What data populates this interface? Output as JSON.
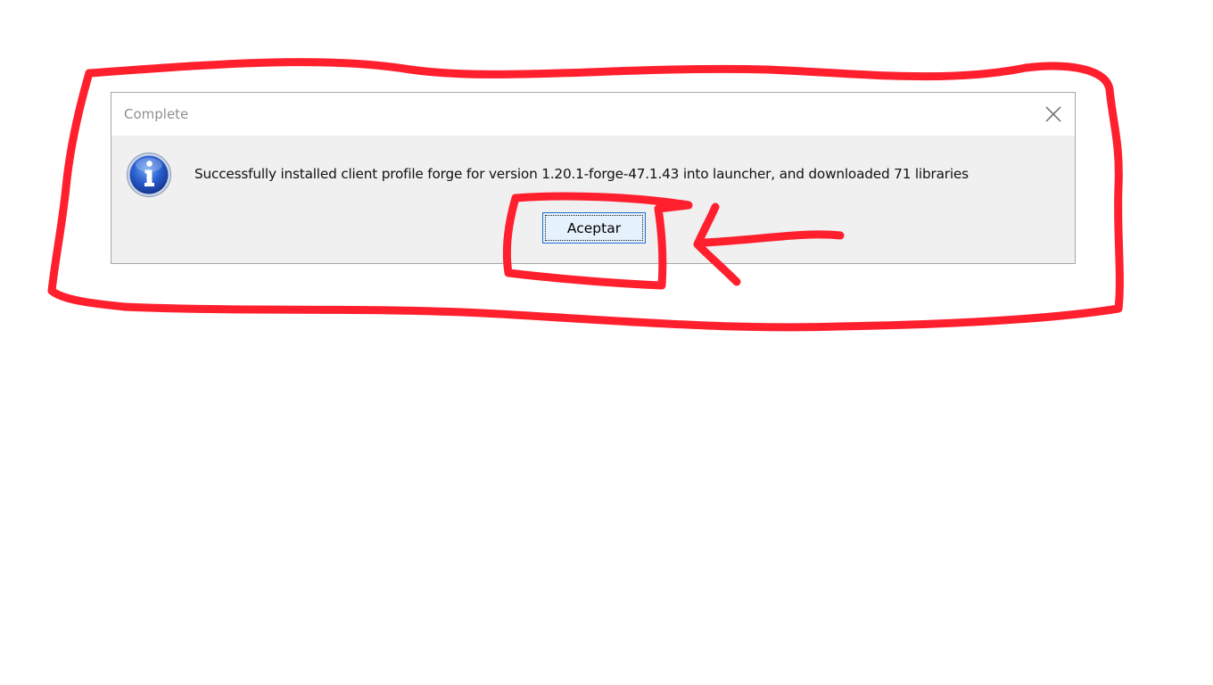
{
  "dialog": {
    "title": "Complete",
    "message": "Successfully installed client profile forge for version 1.20.1-forge-47.1.43 into launcher, and downloaded 71 libraries",
    "ok_label": "Aceptar",
    "icon": "info-icon",
    "close_icon": "close-icon"
  },
  "colors": {
    "annotation": "#ff1f2d",
    "button_border": "#1f6fd0",
    "icon_blue": "#1e4fb8"
  }
}
